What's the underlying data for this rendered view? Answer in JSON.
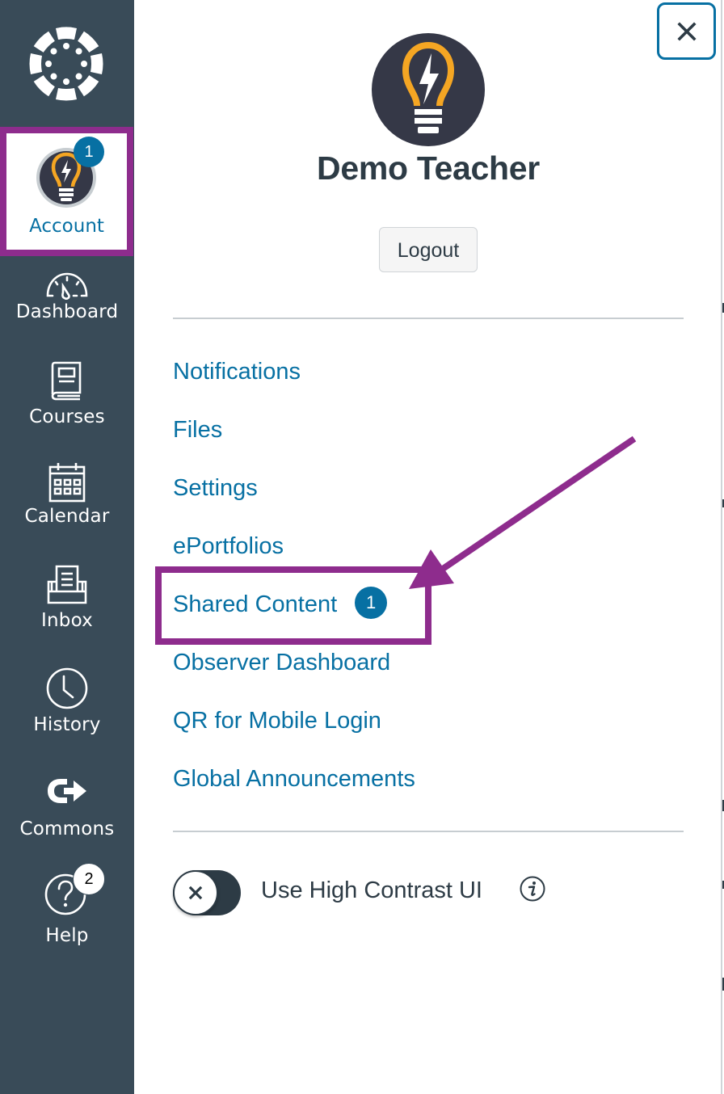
{
  "sidebar": {
    "logo": {
      "icon": "canvas-logo-icon"
    },
    "items": [
      {
        "key": "account",
        "label": "Account",
        "icon": "avatar-lightbulb-icon",
        "badge": "1",
        "active": true,
        "highlighted": true
      },
      {
        "key": "dashboard",
        "label": "Dashboard",
        "icon": "dashboard-gauge-icon"
      },
      {
        "key": "courses",
        "label": "Courses",
        "icon": "book-icon"
      },
      {
        "key": "calendar",
        "label": "Calendar",
        "icon": "calendar-icon"
      },
      {
        "key": "inbox",
        "label": "Inbox",
        "icon": "inbox-icon"
      },
      {
        "key": "history",
        "label": "History",
        "icon": "clock-icon"
      },
      {
        "key": "commons",
        "label": "Commons",
        "icon": "commons-arrow-icon"
      },
      {
        "key": "help",
        "label": "Help",
        "icon": "question-circle-icon",
        "badge": "2"
      }
    ]
  },
  "tray": {
    "close_icon": "close-x-icon",
    "user": {
      "name": "Demo Teacher",
      "avatar": "lightbulb-avatar"
    },
    "logout_label": "Logout",
    "links": [
      {
        "label": "Notifications"
      },
      {
        "label": "Files"
      },
      {
        "label": "Settings"
      },
      {
        "label": "ePortfolios"
      },
      {
        "label": "Shared Content",
        "badge": "1",
        "highlighted": true
      },
      {
        "label": "Observer Dashboard"
      },
      {
        "label": "QR for Mobile Login"
      },
      {
        "label": "Global Announcements"
      }
    ],
    "high_contrast": {
      "label": "Use High Contrast UI",
      "enabled": false,
      "info_icon": "info-icon"
    }
  },
  "colors": {
    "sidebar_bg": "#394B58",
    "link_blue": "#0770A3",
    "text_dark": "#2D3B45",
    "annotation_purple": "#8E2C8D",
    "badge_blue": "#0770A3",
    "avatar_orange": "#F5A623",
    "avatar_dark": "#353847"
  }
}
